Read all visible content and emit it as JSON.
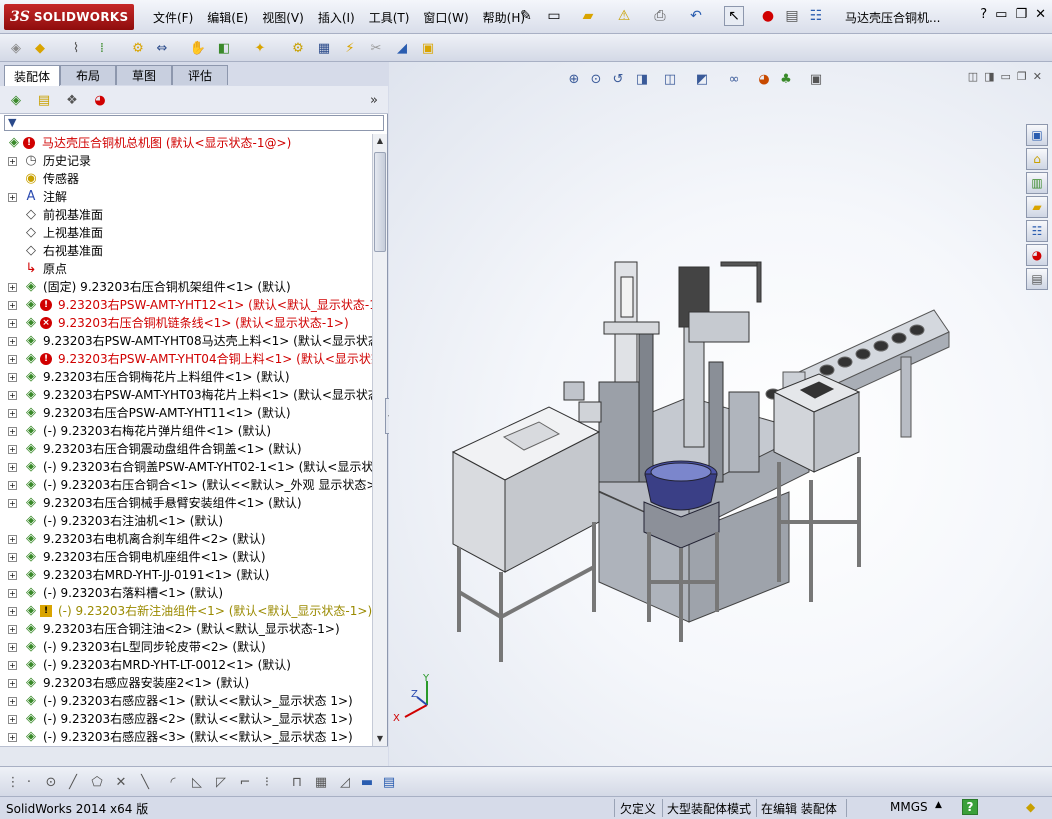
{
  "app": {
    "logo_ds": "3S",
    "logo_text": "SOLIDWORKS",
    "document_title": "马达壳压合铜机...",
    "help_label": "?"
  },
  "menu": [
    {
      "label": "文件(F)"
    },
    {
      "label": "编辑(E)"
    },
    {
      "label": "视图(V)"
    },
    {
      "label": "插入(I)"
    },
    {
      "label": "工具(T)"
    },
    {
      "label": "窗口(W)"
    },
    {
      "label": "帮助(H)"
    }
  ],
  "tabs": [
    {
      "label": "装配体",
      "active": true
    },
    {
      "label": "布局",
      "active": false
    },
    {
      "label": "草图",
      "active": false
    },
    {
      "label": "评估",
      "active": false
    }
  ],
  "tree": {
    "root": {
      "label": "马达壳压合铜机总机图 (默认<显示状态-1@>)",
      "color": "#d00000"
    },
    "items": [
      {
        "label": "历史记录",
        "icon": "history-icon",
        "exp": true,
        "status": "",
        "color": ""
      },
      {
        "label": "传感器",
        "icon": "sensor-icon",
        "exp": false,
        "status": "",
        "color": ""
      },
      {
        "label": "注解",
        "icon": "annotation-icon",
        "exp": true,
        "status": "",
        "color": ""
      },
      {
        "label": "前视基准面",
        "icon": "plane-icon",
        "exp": false,
        "status": "",
        "color": ""
      },
      {
        "label": "上视基准面",
        "icon": "plane-icon",
        "exp": false,
        "status": "",
        "color": ""
      },
      {
        "label": "右视基准面",
        "icon": "plane-icon",
        "exp": false,
        "status": "",
        "color": ""
      },
      {
        "label": "原点",
        "icon": "origin-icon",
        "exp": false,
        "status": "",
        "color": ""
      },
      {
        "label": "(固定) 9.23203右压合铜机架组件<1> (默认)",
        "icon": "assembly-icon",
        "exp": true,
        "status": "",
        "color": ""
      },
      {
        "label": "9.23203右PSW-AMT-YHT12<1> (默认<默认_显示状态-1>)",
        "icon": "assembly-icon",
        "exp": true,
        "status": "rebuild",
        "color": "#d00000"
      },
      {
        "label": "9.23203右压合铜机链条线<1> (默认<显示状态-1>)",
        "icon": "assembly-icon",
        "exp": true,
        "status": "error",
        "color": "#d00000"
      },
      {
        "label": "9.23203右PSW-AMT-YHT08马达壳上料<1> (默认<显示状态-1>)",
        "icon": "assembly-icon",
        "exp": true,
        "status": "",
        "color": ""
      },
      {
        "label": "9.23203右PSW-AMT-YHT04合铜上料<1> (默认<显示状态-1>)",
        "icon": "assembly-icon",
        "exp": true,
        "status": "rebuild",
        "color": "#d00000"
      },
      {
        "label": "9.23203右压合铜梅花片上料组件<1> (默认)",
        "icon": "assembly-icon",
        "exp": true,
        "status": "",
        "color": ""
      },
      {
        "label": "9.23203右PSW-AMT-YHT03梅花片上料<1> (默认<显示状态-1>)",
        "icon": "assembly-icon",
        "exp": true,
        "status": "",
        "color": ""
      },
      {
        "label": "9.23203右压合PSW-AMT-YHT11<1> (默认)",
        "icon": "assembly-icon",
        "exp": true,
        "status": "",
        "color": ""
      },
      {
        "label": "(-) 9.23203右梅花片弹片组件<1> (默认)",
        "icon": "assembly-icon",
        "exp": true,
        "status": "",
        "color": ""
      },
      {
        "label": "9.23203右压合铜震动盘组件合铜盖<1> (默认)",
        "icon": "assembly-icon",
        "exp": true,
        "status": "",
        "color": ""
      },
      {
        "label": "(-) 9.23203右合铜盖PSW-AMT-YHT02-1<1> (默认<显示状态-1>)",
        "icon": "assembly-icon",
        "exp": true,
        "status": "",
        "color": ""
      },
      {
        "label": "(-) 9.23203右压合铜合<1> (默认<<默认>_外观 显示状态>)",
        "icon": "assembly-icon",
        "exp": true,
        "status": "",
        "color": ""
      },
      {
        "label": "9.23203右压合铜械手悬臂安装组件<1> (默认)",
        "icon": "assembly-icon",
        "exp": true,
        "status": "",
        "color": ""
      },
      {
        "label": "(-) 9.23203右注油机<1> (默认)",
        "icon": "assembly-icon",
        "exp": false,
        "status": "",
        "color": ""
      },
      {
        "label": "9.23203右电机离合刹车组件<2> (默认)",
        "icon": "assembly-icon",
        "exp": true,
        "status": "",
        "color": ""
      },
      {
        "label": "9.23203右压合铜电机座组件<1> (默认)",
        "icon": "assembly-icon",
        "exp": true,
        "status": "",
        "color": ""
      },
      {
        "label": "9.23203右MRD-YHT-JJ-0191<1> (默认)",
        "icon": "assembly-icon",
        "exp": true,
        "status": "",
        "color": ""
      },
      {
        "label": "(-) 9.23203右落料槽<1> (默认)",
        "icon": "assembly-icon",
        "exp": true,
        "status": "",
        "color": ""
      },
      {
        "label": "(-) 9.23203右新注油组件<1> (默认<默认_显示状态-1>)",
        "icon": "assembly-icon",
        "exp": true,
        "status": "warning",
        "color": "#9a8a00"
      },
      {
        "label": "9.23203右压合铜注油<2> (默认<默认_显示状态-1>)",
        "icon": "assembly-icon",
        "exp": true,
        "status": "",
        "color": ""
      },
      {
        "label": "(-) 9.23203右L型同步轮皮带<2> (默认)",
        "icon": "assembly-icon",
        "exp": true,
        "status": "",
        "color": ""
      },
      {
        "label": "(-) 9.23203右MRD-YHT-LT-0012<1> (默认)",
        "icon": "assembly-icon",
        "exp": true,
        "status": "",
        "color": ""
      },
      {
        "label": "9.23203右感应器安装座2<1> (默认)",
        "icon": "assembly-icon",
        "exp": true,
        "status": "",
        "color": ""
      },
      {
        "label": "(-) 9.23203右感应器<1> (默认<<默认>_显示状态 1>)",
        "icon": "assembly-icon",
        "exp": true,
        "status": "",
        "color": ""
      },
      {
        "label": "(-) 9.23203右感应器<2> (默认<<默认>_显示状态 1>)",
        "icon": "assembly-icon",
        "exp": true,
        "status": "",
        "color": ""
      },
      {
        "label": "(-) 9.23203右感应器<3> (默认<<默认>_显示状态 1>)",
        "icon": "assembly-icon",
        "exp": true,
        "status": "",
        "color": ""
      }
    ]
  },
  "triad": {
    "x": "X",
    "y": "Y",
    "z": "Z"
  },
  "status": {
    "version": "SolidWorks 2014 x64 版",
    "underdefined": "欠定义",
    "mode": "大型装配体模式",
    "editing": "在编辑 装配体",
    "units": "MMGS",
    "help": "?"
  },
  "colors": {
    "accent": "#c62828",
    "error": "#d00000",
    "warning": "#9a8a00",
    "panel": "#d6dbe9"
  }
}
